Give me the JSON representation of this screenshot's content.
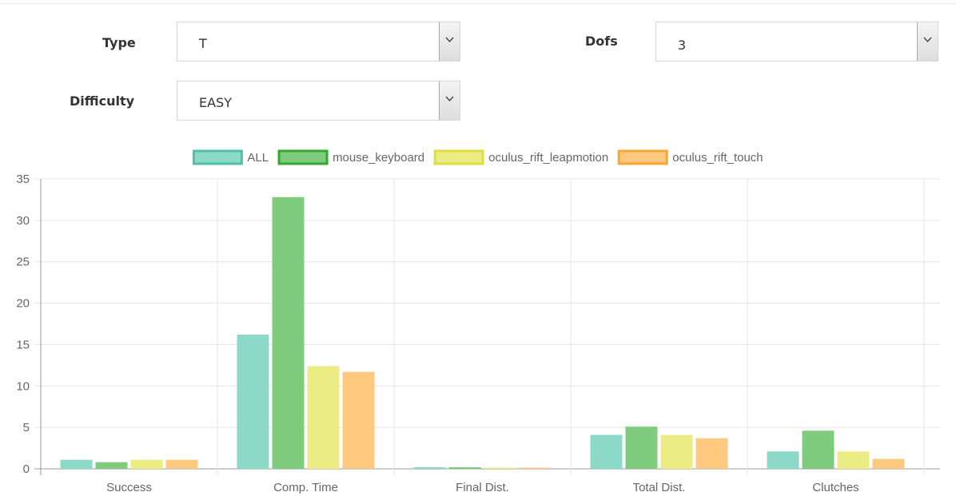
{
  "filters": {
    "type": {
      "label": "Type",
      "value": "T"
    },
    "dofs": {
      "label": "Dofs",
      "value": "3"
    },
    "difficulty": {
      "label": "Difficulty",
      "value": "EASY"
    }
  },
  "chart_data": {
    "type": "bar",
    "categories": [
      "Success",
      "Comp. Time",
      "Final Dist.",
      "Total Dist.",
      "Clutches"
    ],
    "series": [
      {
        "name": "ALL",
        "values": [
          1.1,
          16.2,
          0.2,
          4.1,
          2.1
        ],
        "color": "#8cd9c8",
        "border": "#4fc1a8"
      },
      {
        "name": "mouse_keyboard",
        "values": [
          0.8,
          32.8,
          0.2,
          5.1,
          4.6
        ],
        "color": "#7fcc7f",
        "border": "#2eaa2e"
      },
      {
        "name": "oculus_rift_leapmotion",
        "values": [
          1.1,
          12.4,
          0.15,
          4.1,
          2.1
        ],
        "color": "#ecec85",
        "border": "#dede3c"
      },
      {
        "name": "oculus_rift_touch",
        "values": [
          1.1,
          11.7,
          0.15,
          3.7,
          1.2
        ],
        "color": "#fec97f",
        "border": "#fda530"
      }
    ],
    "ylim": [
      0,
      35
    ],
    "yticks": [
      0,
      5,
      10,
      15,
      20,
      25,
      30,
      35
    ],
    "grid": true,
    "legend": "top-center",
    "xlabel": "",
    "ylabel": ""
  }
}
